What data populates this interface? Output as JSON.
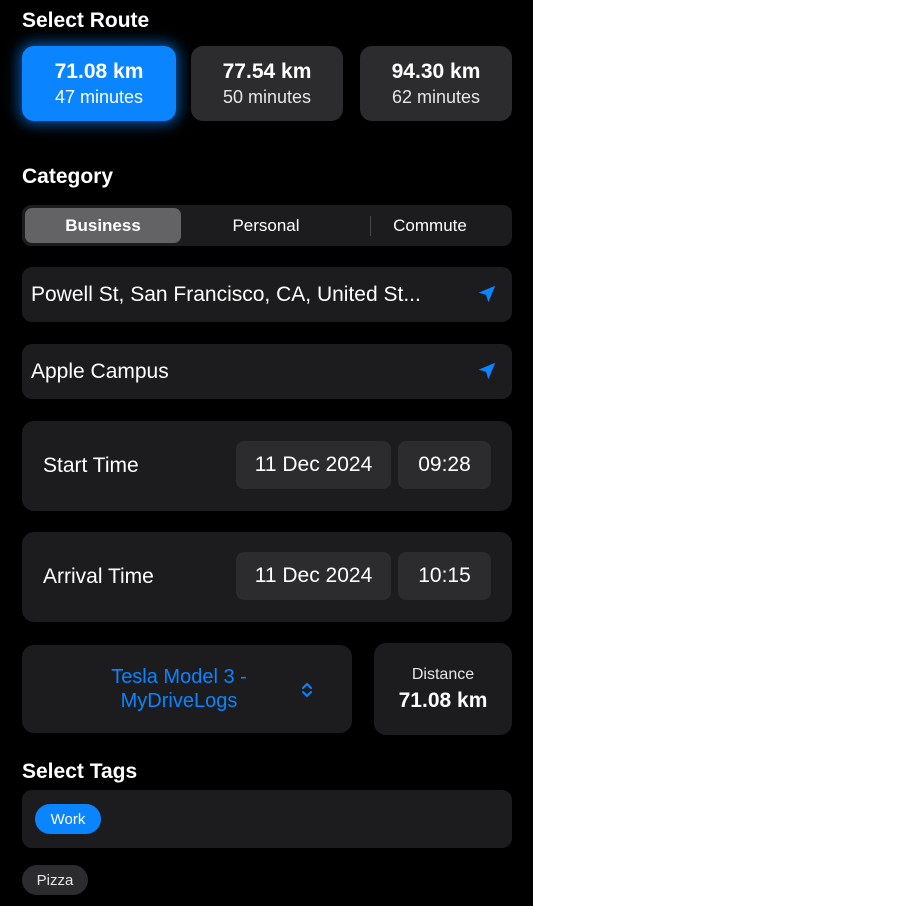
{
  "select_route": {
    "title": "Select Route",
    "routes": [
      {
        "distance": "71.08 km",
        "duration": "47 minutes",
        "selected": true
      },
      {
        "distance": "77.54 km",
        "duration": "50 minutes",
        "selected": false
      },
      {
        "distance": "94.30 km",
        "duration": "62 minutes",
        "selected": false
      }
    ]
  },
  "category": {
    "title": "Category",
    "options": [
      "Business",
      "Personal",
      "Commute"
    ],
    "selected": "Business"
  },
  "start_location": {
    "value": "Powell St, San Francisco, CA, United St...",
    "icon": "location-arrow-icon"
  },
  "end_location": {
    "value": "Apple Campus",
    "icon": "location-arrow-icon"
  },
  "start_time": {
    "label": "Start Time",
    "date": "11 Dec 2024",
    "time": "09:28"
  },
  "arrival_time": {
    "label": "Arrival Time",
    "date": "11 Dec 2024",
    "time": "10:15"
  },
  "vehicle": {
    "line1": "Tesla Model 3 -",
    "line2": "MyDriveLogs",
    "icon": "chevron-up-down-icon"
  },
  "distance": {
    "label": "Distance",
    "value": "71.08 km"
  },
  "tags": {
    "title": "Select Tags",
    "items": [
      {
        "label": "Work",
        "selected": true
      },
      {
        "label": "Pizza",
        "selected": false
      }
    ]
  },
  "colors": {
    "accent": "#0a84ff",
    "background": "#000000",
    "card": "#1c1c1e",
    "pill": "#2c2c2e"
  }
}
